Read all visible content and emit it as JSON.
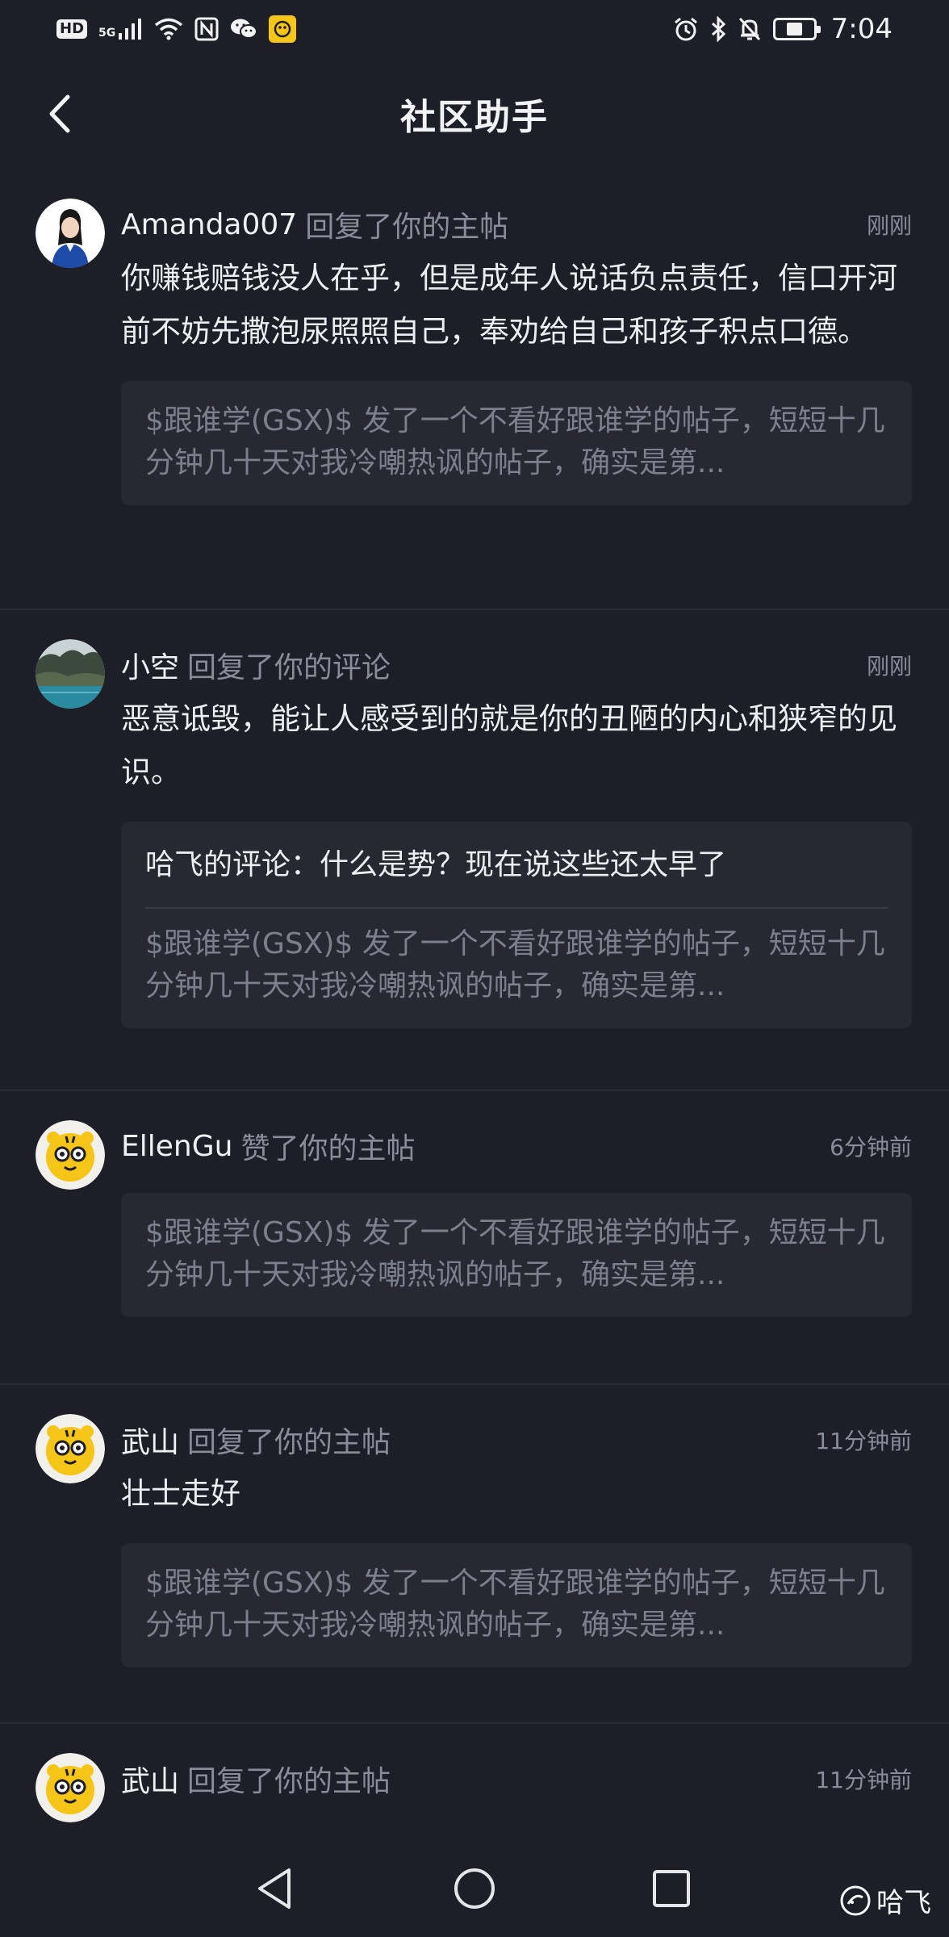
{
  "status_bar": {
    "hd_label": "HD",
    "network_label": "5G",
    "time": "7:04",
    "battery_level": 0.45
  },
  "header": {
    "title": "社区助手"
  },
  "notifications": [
    {
      "user": "Amanda007",
      "action": "回复了你的主帖",
      "time": "刚刚",
      "body": "你赚钱赔钱没人在乎，但是成年人说话负点责任，信口开河前不妨先撒泡尿照照自己，奉劝给自己和孩子积点口德。",
      "quote": "$跟谁学(GSX)$ 发了一个不看好跟谁学的帖子，短短十几分钟几十天对我冷嘲热讽的帖子，确实是第..."
    },
    {
      "user": "小空",
      "action": "回复了你的评论",
      "time": "刚刚",
      "body": "恶意诋毁，能让人感受到的就是你的丑陋的内心和狭窄的见识。",
      "quoted_comment": "哈飞的评论：什么是势？现在说这些还太早了",
      "quote": "$跟谁学(GSX)$ 发了一个不看好跟谁学的帖子，短短十几分钟几十天对我冷嘲热讽的帖子，确实是第..."
    },
    {
      "user": "EllenGu",
      "action": "赞了你的主帖",
      "time": "6分钟前",
      "quote": "$跟谁学(GSX)$ 发了一个不看好跟谁学的帖子，短短十几分钟几十天对我冷嘲热讽的帖子，确实是第..."
    },
    {
      "user": "武山",
      "action": "回复了你的主帖",
      "time": "11分钟前",
      "body": "壮士走好",
      "quote": "$跟谁学(GSX)$ 发了一个不看好跟谁学的帖子，短短十几分钟几十天对我冷嘲热讽的帖子，确实是第..."
    },
    {
      "user": "武山",
      "action": "回复了你的主帖",
      "time": "11分钟前"
    }
  ],
  "watermark": {
    "text": "哈飞"
  },
  "colors": {
    "background": "#1d1e27",
    "quote_background": "#272832",
    "muted_text": "#8a8c9a",
    "tiger_yellow": "#f5c518"
  }
}
